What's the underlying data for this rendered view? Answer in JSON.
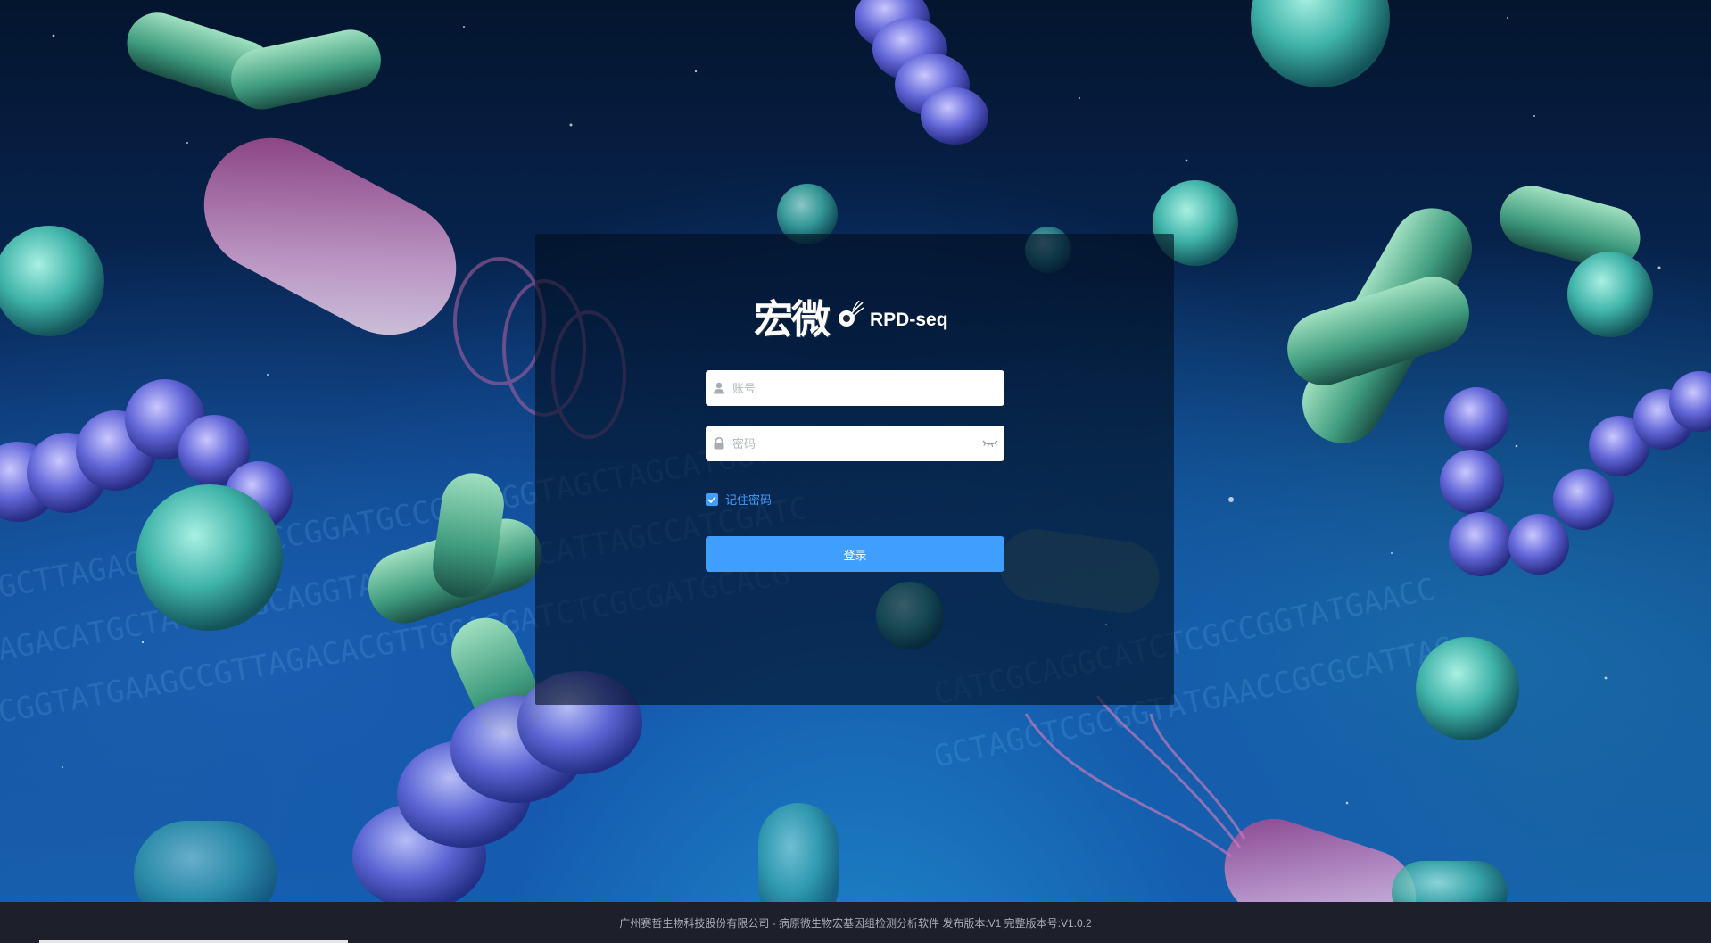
{
  "logo": {
    "chinese_name": "宏微",
    "product_name": "RPD-seq"
  },
  "login_form": {
    "account_placeholder": "账号",
    "password_placeholder": "密码",
    "remember_label": "记住密码",
    "remember_checked": true,
    "login_button": "登录"
  },
  "footer": {
    "text": "广州赛哲生物科技股份有限公司 - 病原微生物宏基因组检测分析软件 发布版本:V1 完整版本号:V1.0.2"
  },
  "colors": {
    "primary": "#409eff",
    "footer_bg": "#1d1f2b",
    "panel_bg": "rgba(2,14,32,0.62)"
  },
  "icons": [
    "user-icon",
    "lock-icon",
    "eye-closed-icon",
    "check-icon"
  ]
}
